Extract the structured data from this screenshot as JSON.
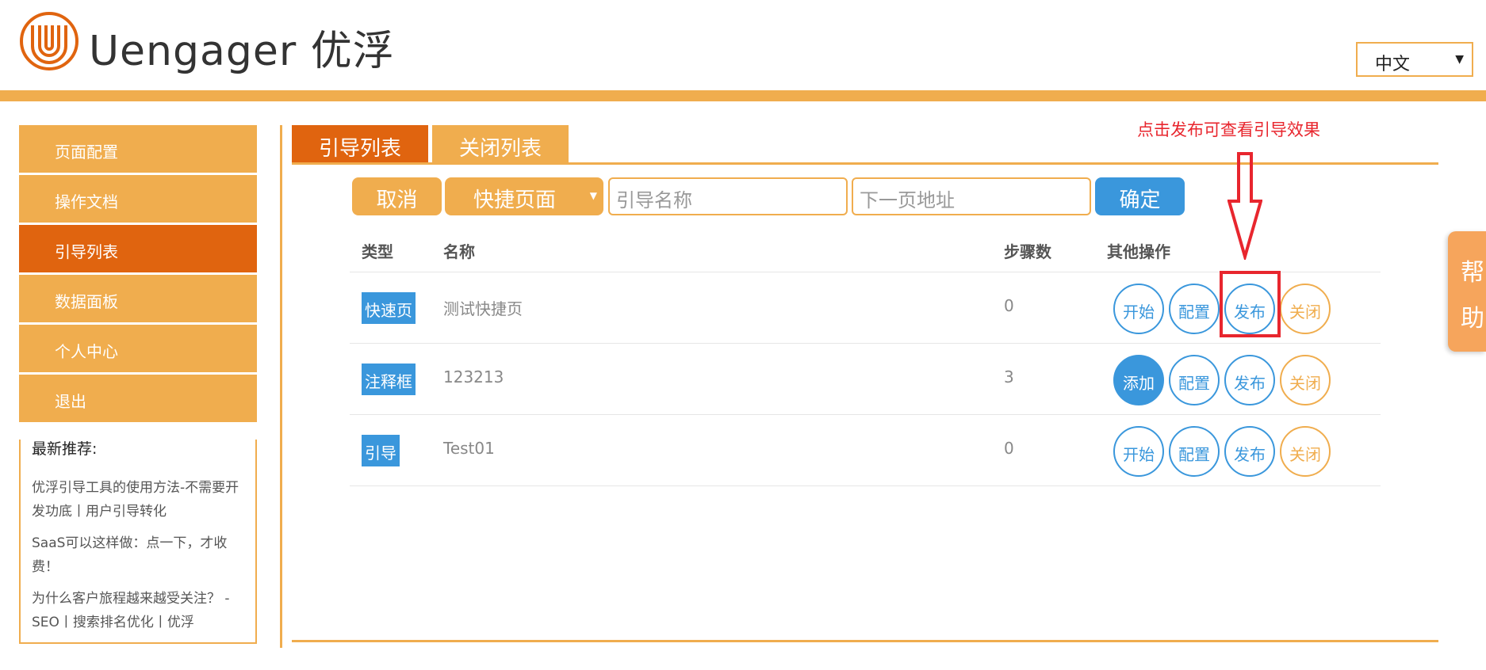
{
  "header": {
    "brand": "Uengager 优浮",
    "language": "中文",
    "colors": {
      "accent": "#f0ad4e",
      "active": "#e0640f",
      "blue": "#3a97dc"
    }
  },
  "sidebar": {
    "items": [
      {
        "label": "页面配置",
        "active": false
      },
      {
        "label": "操作文档",
        "active": false
      },
      {
        "label": "引导列表",
        "active": true
      },
      {
        "label": "数据面板",
        "active": false
      },
      {
        "label": "个人中心",
        "active": false
      },
      {
        "label": "退出",
        "active": false
      }
    ],
    "recommend": {
      "title": "最新推荐:",
      "links": [
        "优浮引导工具的使用方法-不需要开发功底丨用户引导转化",
        "SaaS可以这样做：点一下，才收费！",
        "为什么客户旅程越来越受关注？ -SEO丨搜索排名优化丨优浮"
      ]
    }
  },
  "tabs": {
    "guide_list": "引导列表",
    "closed_list": "关闭列表"
  },
  "toolbar": {
    "cancel": "取消",
    "type_select": "快捷页面",
    "name_placeholder": "引导名称",
    "next_placeholder": "下一页地址",
    "confirm": "确定"
  },
  "table": {
    "headers": {
      "type": "类型",
      "name": "名称",
      "steps": "步骤数",
      "ops": "其他操作"
    },
    "rows": [
      {
        "type": "快速页",
        "name": "测试快捷页",
        "steps": "0",
        "op1": "开始",
        "op2": "配置",
        "op3": "发布",
        "op4": "关闭"
      },
      {
        "type": "注释框",
        "name": "123213",
        "steps": "3",
        "op1": "添加",
        "op2": "配置",
        "op3": "发布",
        "op4": "关闭"
      },
      {
        "type": "引导",
        "name": "Test01",
        "steps": "0",
        "op1": "开始",
        "op2": "配置",
        "op3": "发布",
        "op4": "关闭"
      }
    ]
  },
  "annotation": {
    "text": "点击发布可查看引导效果"
  },
  "help": {
    "line1": "帮",
    "line2": "助"
  }
}
